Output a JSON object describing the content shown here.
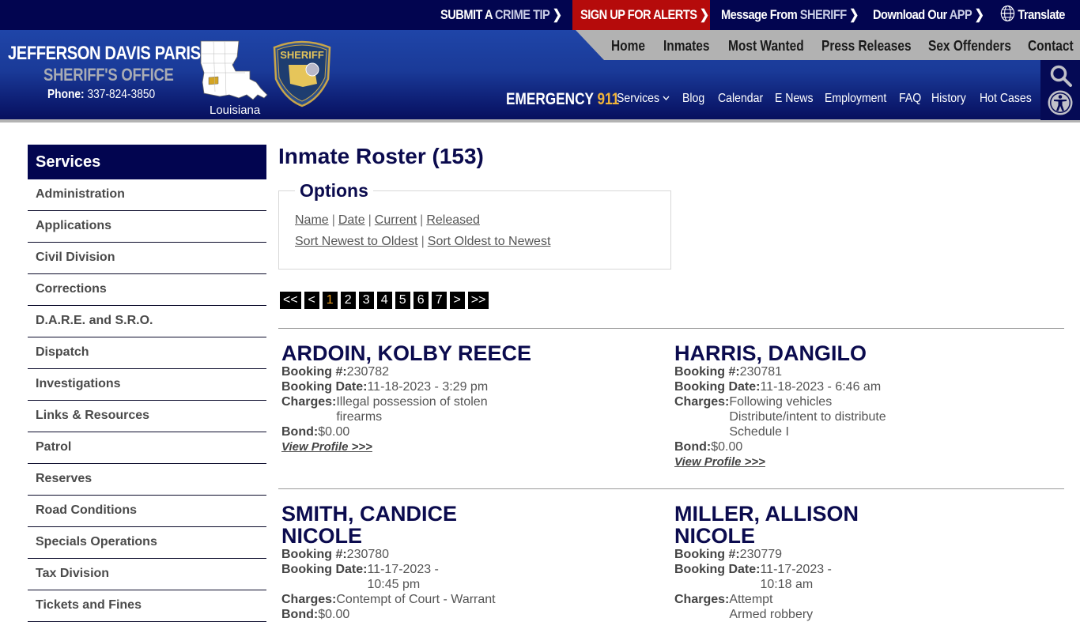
{
  "topbar": {
    "links": [
      {
        "main": "SUBMIT A ",
        "light": "CRIME TIP"
      },
      {
        "main": "SIGN UP FOR ALERTS",
        "light": ""
      },
      {
        "main": "Message From ",
        "light": "SHERIFF"
      },
      {
        "main": "Download Our ",
        "light": "APP"
      }
    ],
    "translate": "Translate",
    "chevron": "❯",
    "alert_color": "#b50b0b"
  },
  "brand": {
    "title": "JEFFERSON DAVIS PARISH",
    "subtitle": "SHERIFF'S OFFICE",
    "phone_label": "Phone:",
    "phone": "337-824-3850",
    "map_label": "Louisiana",
    "badge_text": "SHERIFF"
  },
  "graynav": [
    "Home",
    "Inmates",
    "Most Wanted",
    "Press Releases",
    "Sex Offenders",
    "Contact"
  ],
  "bluenav": {
    "emergency": "EMERGENCY",
    "emergency_num": "911",
    "items": [
      "Services",
      "Blog",
      "Calendar",
      "E News",
      "Employment",
      "FAQ",
      "History",
      "Hot Cases"
    ]
  },
  "sidebar": {
    "heading": "Services",
    "items": [
      "Administration",
      "Applications",
      "Civil Division",
      "Corrections",
      "D.A.R.E. and S.R.O.",
      "Dispatch",
      "Investigations",
      "Links & Resources",
      "Patrol",
      "Reserves",
      "Road Conditions",
      "Specials Operations",
      "Tax Division",
      "Tickets and Fines"
    ]
  },
  "main": {
    "title": "Inmate Roster (153)",
    "options": {
      "legend": "Options",
      "filters": [
        "Name",
        "Date",
        "Current",
        "Released"
      ],
      "sorts": [
        "Sort Newest to Oldest",
        "Sort Oldest to Newest"
      ],
      "separator": "|"
    },
    "pager": {
      "first": "<<",
      "prev": "<",
      "pages": [
        "1",
        "2",
        "3",
        "4",
        "5",
        "6",
        "7"
      ],
      "current": "1",
      "next": ">",
      "last": ">>"
    },
    "labels": {
      "booking_no": "Booking #:",
      "booking_date": "Booking Date:",
      "charges": "Charges:",
      "bond": "Bond:",
      "view_profile": "View Profile >>>"
    },
    "inmates": [
      {
        "name": "ARDOIN, KOLBY REECE",
        "booking_no": "230782",
        "booking_date": "11-18-2023 - 3:29 pm",
        "charges": [
          "Illegal possession of stolen",
          "firearms"
        ],
        "bond": "$0.00"
      },
      {
        "name": "HARRIS, DANGILO",
        "booking_no": "230781",
        "booking_date": "11-18-2023 - 6:46 am",
        "charges": [
          "Following vehicles",
          "Distribute/intent to distribute",
          "Schedule I"
        ],
        "bond": "$0.00"
      },
      {
        "name": "SMITH, CANDICE NICOLE",
        "booking_no": "230780",
        "booking_date": "11-17-2023 - 10:45 pm",
        "charges": [
          "Contempt of Court - Warrant"
        ],
        "bond": "$0.00"
      },
      {
        "name": "MILLER, ALLISON NICOLE",
        "booking_no": "230779",
        "booking_date": "11-17-2023 - 10:18 am",
        "charges": [
          "Attempt",
          "Armed robbery"
        ],
        "bond": ""
      }
    ]
  }
}
